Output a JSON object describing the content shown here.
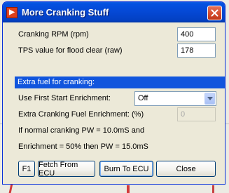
{
  "window": {
    "title": "More Cranking Stuff"
  },
  "fields": {
    "cranking_rpm_label": "Cranking RPM (rpm)",
    "cranking_rpm_value": "400",
    "tps_flood_label": "TPS value for flood clear (raw)",
    "tps_flood_value": "178"
  },
  "section": {
    "extra_fuel_header": "Extra fuel for cranking:"
  },
  "enrichment": {
    "first_start_label": "Use First Start Enrichment:",
    "first_start_selected": "Off",
    "extra_fuel_label": "Extra Cranking Fuel Enrichment:  (%)",
    "extra_fuel_value": "0",
    "note_line1": "If normal cranking PW = 10.0mS  and",
    "note_line2": "Enrichment = 50% then PW = 15.0mS"
  },
  "buttons": {
    "f1": "F1",
    "fetch": "Fetch From ECU",
    "burn": "Burn To ECU",
    "close": "Close"
  },
  "colors": {
    "titlebar": "#0451e0",
    "section_bar": "#1155dd",
    "close_button": "#d24a2a"
  }
}
